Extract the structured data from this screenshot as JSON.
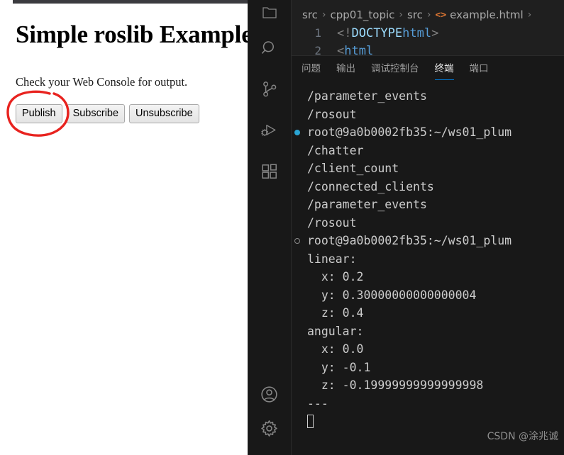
{
  "browser": {
    "heading": "Simple roslib Example",
    "paragraph": "Check your Web Console for output.",
    "buttons": [
      {
        "label": "Publish",
        "name": "publish-button"
      },
      {
        "label": "Subscribe",
        "name": "subscribe-button"
      },
      {
        "label": "Unsubscribe",
        "name": "unsubscribe-button"
      }
    ],
    "annotation_color": "#e8231f"
  },
  "vscode": {
    "activity_bar": [
      {
        "icon": "explorer-icon",
        "label": "Explorer"
      },
      {
        "icon": "search-icon",
        "label": "Search"
      },
      {
        "icon": "source-control-icon",
        "label": "Source Control"
      },
      {
        "icon": "run-and-debug-icon",
        "label": "Run and Debug"
      },
      {
        "icon": "extensions-icon",
        "label": "Extensions"
      },
      {
        "icon": "account-icon",
        "label": "Accounts"
      },
      {
        "icon": "gear-icon",
        "label": "Manage"
      }
    ],
    "breadcrumb": {
      "items": [
        "src",
        "cpp01_topic",
        "src",
        "example.html"
      ],
      "file_icon": "<>",
      "separator": "›",
      "trailing_separator": "›"
    },
    "editor": {
      "lines": [
        {
          "number": "1",
          "punct_open": "<!",
          "doctype": "DOCTYPE",
          "tag": " html",
          "punct_close": ">"
        },
        {
          "number": "2",
          "punct_open": "<",
          "doctype": "",
          "tag": "html",
          "punct_close": ""
        }
      ]
    },
    "panel": {
      "tabs": [
        {
          "label": "问题",
          "active": false,
          "name": "tab-problems"
        },
        {
          "label": "输出",
          "active": false,
          "name": "tab-output"
        },
        {
          "label": "调试控制台",
          "active": false,
          "name": "tab-debug-console"
        },
        {
          "label": "终端",
          "active": true,
          "name": "tab-terminal"
        },
        {
          "label": "端口",
          "active": false,
          "name": "tab-ports"
        }
      ],
      "terminal_lines": [
        {
          "text": "/parameter_events",
          "deco": "none"
        },
        {
          "text": "/rosout",
          "deco": "none"
        },
        {
          "text": "root@9a0b0002fb35:~/ws01_plum",
          "deco": "filled"
        },
        {
          "text": "/chatter",
          "deco": "none"
        },
        {
          "text": "/client_count",
          "deco": "none"
        },
        {
          "text": "/connected_clients",
          "deco": "none"
        },
        {
          "text": "/parameter_events",
          "deco": "none"
        },
        {
          "text": "/rosout",
          "deco": "none"
        },
        {
          "text": "root@9a0b0002fb35:~/ws01_plum",
          "deco": "hollow"
        },
        {
          "text": "linear:",
          "deco": "none"
        },
        {
          "text": "  x: 0.2",
          "deco": "none"
        },
        {
          "text": "  y: 0.30000000000000004",
          "deco": "none"
        },
        {
          "text": "  z: 0.4",
          "deco": "none"
        },
        {
          "text": "angular:",
          "deco": "none"
        },
        {
          "text": "  x: 0.0",
          "deco": "none"
        },
        {
          "text": "  y: -0.1",
          "deco": "none"
        },
        {
          "text": "  z: -0.19999999999999998",
          "deco": "none"
        },
        {
          "text": "---",
          "deco": "none"
        },
        {
          "text": "",
          "deco": "none",
          "cursor": true
        }
      ]
    }
  },
  "watermark": "CSDN @涂兆诚"
}
